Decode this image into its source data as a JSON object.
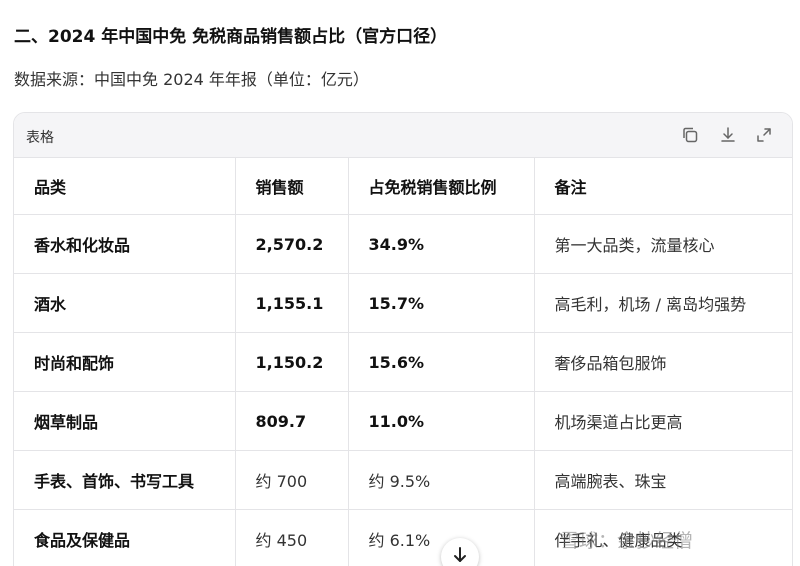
{
  "heading": "二、2024 年中国中免 免税商品销售额占比（官方口径）",
  "source": "数据来源：中国中免 2024 年年报（单位：亿元）",
  "table_card": {
    "title": "表格",
    "tools": [
      "copy-icon",
      "download-icon",
      "expand-icon"
    ]
  },
  "table": {
    "headers": [
      "品类",
      "销售额",
      "占免税销售额比例",
      "备注"
    ],
    "rows": [
      {
        "category": "香水和化妆品",
        "sales": "2,570.2",
        "ratio": "34.9%",
        "note": "第一大品类，流量核心"
      },
      {
        "category": "酒水",
        "sales": "1,155.1",
        "ratio": "15.7%",
        "note": "高毛利，机场 / 离岛均强势"
      },
      {
        "category": "时尚和配饰",
        "sales": "1,150.2",
        "ratio": "15.6%",
        "note": "奢侈品箱包服饰"
      },
      {
        "category": "烟草制品",
        "sales": "809.7",
        "ratio": "11.0%",
        "note": "机场渠道占比更高"
      },
      {
        "category": "手表、首饰、书写工具",
        "sales": "约 700",
        "ratio": "约 9.5%",
        "note": "高端腕表、珠宝"
      },
      {
        "category": "食品及保健品",
        "sales": "约 450",
        "ratio": "约 6.1%",
        "note": "伴手礼、健康品类"
      }
    ]
  },
  "watermark": "雪球：余抄经僧"
}
